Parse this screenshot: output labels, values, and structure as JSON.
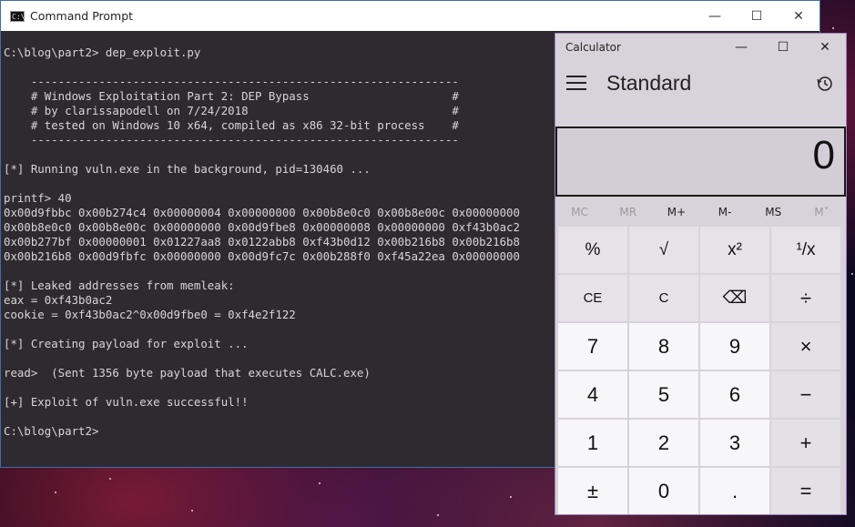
{
  "cmd": {
    "title": "Command Prompt",
    "icon_label": "C:\\",
    "lines": [
      "C:\\blog\\part2> dep_exploit.py",
      "",
      "    ---------------------------------------------------------------",
      "    # Windows Exploitation Part 2: DEP Bypass                     #",
      "    # by clarissapodell on 7/24/2018                              #",
      "    # tested on Windows 10 x64, compiled as x86 32-bit process    #",
      "    ---------------------------------------------------------------",
      "",
      "[*] Running vuln.exe in the background, pid=130460 ...",
      "",
      "printf> 40",
      "0x00d9fbbc 0x00b274c4 0x00000004 0x00000000 0x00b8e0c0 0x00b8e00c 0x00000000",
      "0x00b8e0c0 0x00b8e00c 0x00000000 0x00d9fbe8 0x00000008 0x00000000 0xf43b0ac2",
      "0x00b277bf 0x00000001 0x01227aa8 0x0122abb8 0xf43b0d12 0x00b216b8 0x00b216b8",
      "0x00b216b8 0x00d9fbfc 0x00000000 0x00d9fc7c 0x00b288f0 0xf45a22ea 0x00000000",
      "",
      "[*] Leaked addresses from memleak:",
      "eax = 0xf43b0ac2",
      "cookie = 0xf43b0ac2^0x00d9fbe0 = 0xf4e2f122",
      "",
      "[*] Creating payload for exploit ...",
      "",
      "read>  (Sent 1356 byte payload that executes CALC.exe)",
      "",
      "[+] Exploit of vuln.exe successful!!",
      "",
      "C:\\blog\\part2>"
    ]
  },
  "calc": {
    "title": "Calculator",
    "mode": "Standard",
    "display": "0",
    "memory": [
      "MC",
      "MR",
      "M+",
      "M-",
      "MS",
      "M˅"
    ],
    "keys": [
      "%",
      "√",
      "x²",
      "¹/x",
      "CE",
      "C",
      "⌫",
      "÷",
      "7",
      "8",
      "9",
      "×",
      "4",
      "5",
      "6",
      "−",
      "1",
      "2",
      "3",
      "+",
      "±",
      "0",
      ".",
      "="
    ]
  },
  "window_controls": {
    "minimize": "—",
    "maximize": "☐",
    "close": "✕"
  }
}
